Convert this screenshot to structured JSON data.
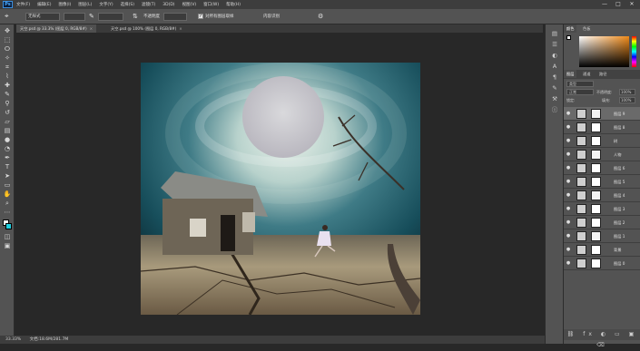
{
  "app": {
    "logo": "Ps"
  },
  "menu": [
    "文件(F)",
    "编辑(E)",
    "图像(I)",
    "图层(L)",
    "文字(Y)",
    "选择(S)",
    "滤镜(T)",
    "3D(D)",
    "视图(V)",
    "窗口(W)",
    "帮助(H)"
  ],
  "window_controls": {
    "minimize": "—",
    "maximize": "□",
    "close": "✕"
  },
  "options": {
    "style_field": "无样式",
    "brush_size": "",
    "flow_field": "",
    "opacity_label": "不透明度",
    "sample_all_label": "对所有图层取样",
    "check_mark": "✓",
    "extra_label": "内容识别",
    "tool_glyph": "⇅"
  },
  "tabs": [
    {
      "label": "天空.psd @ 33.3% (图层 0, RGB/8#)",
      "close": "×"
    },
    {
      "label": "天空.psd @ 100% (图层 0, RGB/8#)",
      "close": "×"
    }
  ],
  "panel_tabs": {
    "top": [
      "颜色",
      "色板"
    ],
    "middle": [
      "图层",
      "通道",
      "路径"
    ]
  },
  "layers_panel": {
    "kind_label": "类型",
    "blend_mode": "正常",
    "opacity_label": "不透明度:",
    "opacity_value": "100%",
    "lock_label": "锁定:",
    "fill_label": "填充:",
    "fill_value": "100%",
    "eye_glyph": "●",
    "layers": [
      {
        "name": "图层 9"
      },
      {
        "name": "图层 8"
      },
      {
        "name": "树"
      },
      {
        "name": "人物"
      },
      {
        "name": "图层 6"
      },
      {
        "name": "图层 5"
      },
      {
        "name": "图层 4"
      },
      {
        "name": "图层 3"
      },
      {
        "name": "图层 2"
      },
      {
        "name": "图层 1"
      },
      {
        "name": "背景"
      },
      {
        "name": "图层 0"
      }
    ]
  },
  "status": {
    "zoom": "33.33%",
    "doc_info": "文档:18.6M/281.7M"
  },
  "colors": {
    "accent": "#0f3742",
    "sky_glow": "#cfe0d8",
    "ground": "#a08e70"
  }
}
